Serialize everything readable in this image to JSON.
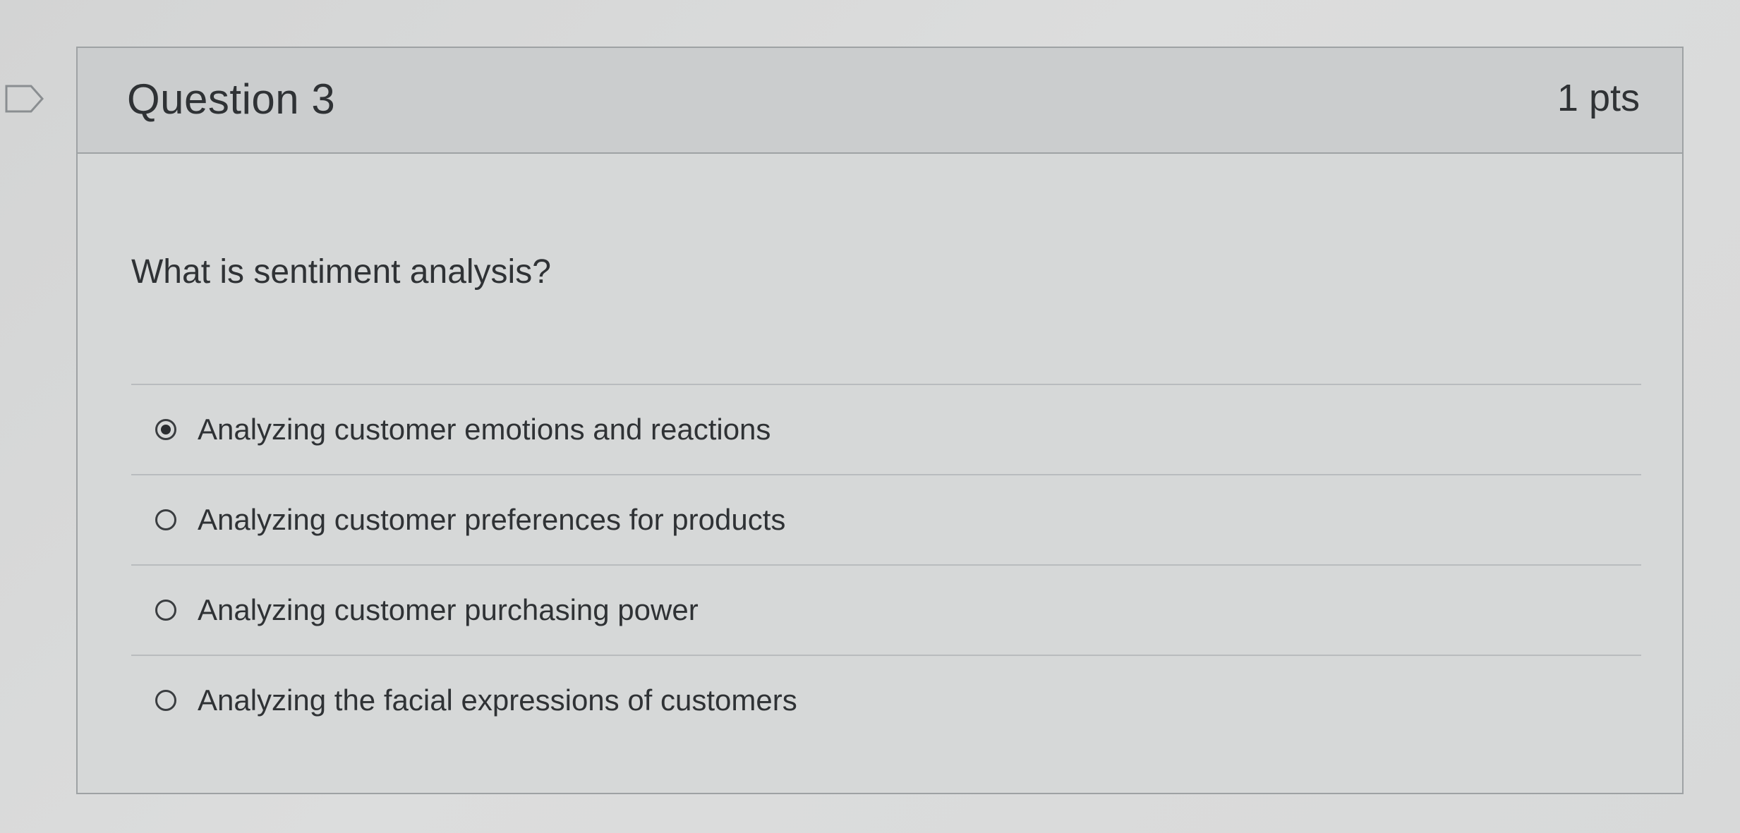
{
  "question": {
    "title": "Question 3",
    "points": "1 pts",
    "text": "What is sentiment analysis?",
    "flag_icon": "flag-outline-icon"
  },
  "answers": [
    {
      "label": "Analyzing customer emotions and reactions",
      "selected": true
    },
    {
      "label": "Analyzing customer preferences for products",
      "selected": false
    },
    {
      "label": "Analyzing customer purchasing power",
      "selected": false
    },
    {
      "label": "Analyzing the facial expressions of customers",
      "selected": false
    }
  ],
  "colors": {
    "text": "#2f3235",
    "border": "#9ea2a4",
    "header_bg": "#cbcdce"
  }
}
